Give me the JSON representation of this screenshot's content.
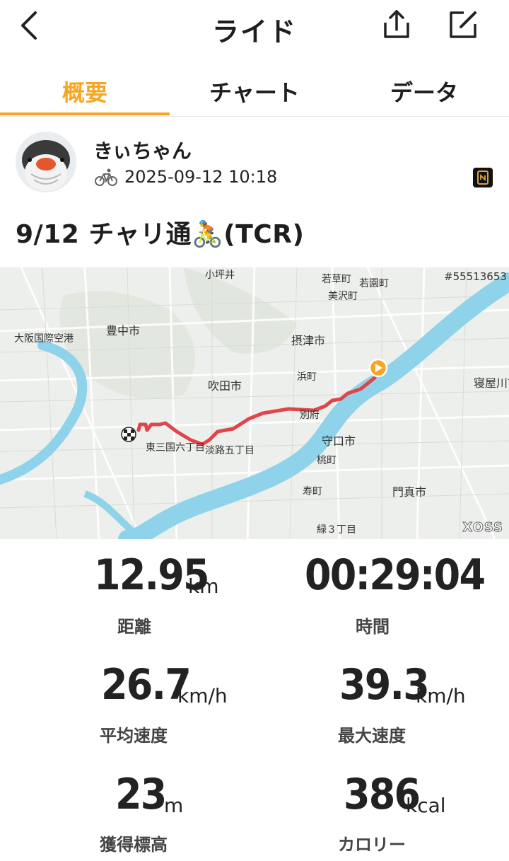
{
  "header": {
    "title": "ライド",
    "back_icon": "chevron-left-icon",
    "share_icon": "share-icon",
    "edit_icon": "edit-icon"
  },
  "tabs": [
    {
      "label": "概要",
      "active": true
    },
    {
      "label": "チャート",
      "active": false
    },
    {
      "label": "データ",
      "active": false
    }
  ],
  "profile": {
    "name": "きぃちゃん",
    "datetime": "2025-09-12 10:18",
    "activity_icon": "bicycle-icon",
    "device_icon": "device-icon"
  },
  "ride": {
    "title": "9/12 チャリ通🚴(TCR)"
  },
  "map": {
    "id_text": "#55513653",
    "watermark": "XOSS",
    "labels": [
      "豊中市",
      "大阪国際空港",
      "摂津市",
      "吹田市",
      "寝屋川市",
      "守口市",
      "門真市",
      "東三国六丁目",
      "淡路五丁目",
      "浜町",
      "別府",
      "桃町",
      "寿町",
      "緑３丁目",
      "若草町",
      "若園町",
      "美沢町",
      "小坪井"
    ]
  },
  "stats": {
    "distance": {
      "value": "12.95",
      "unit": "km",
      "label": "距離"
    },
    "time": {
      "value": "00:29:04",
      "unit": "",
      "label": "時間"
    },
    "avg_speed": {
      "value": "26.7",
      "unit": "km/h",
      "label": "平均速度"
    },
    "max_speed": {
      "value": "39.3",
      "unit": "km/h",
      "label": "最大速度"
    },
    "elevation": {
      "value": "23",
      "unit": "m",
      "label": "獲得標高"
    },
    "calories": {
      "value": "386",
      "unit": "kcal",
      "label": "カロリー"
    }
  },
  "colors": {
    "accent": "#f5a623",
    "route": "#e0454b",
    "river": "#8fd3ea"
  }
}
